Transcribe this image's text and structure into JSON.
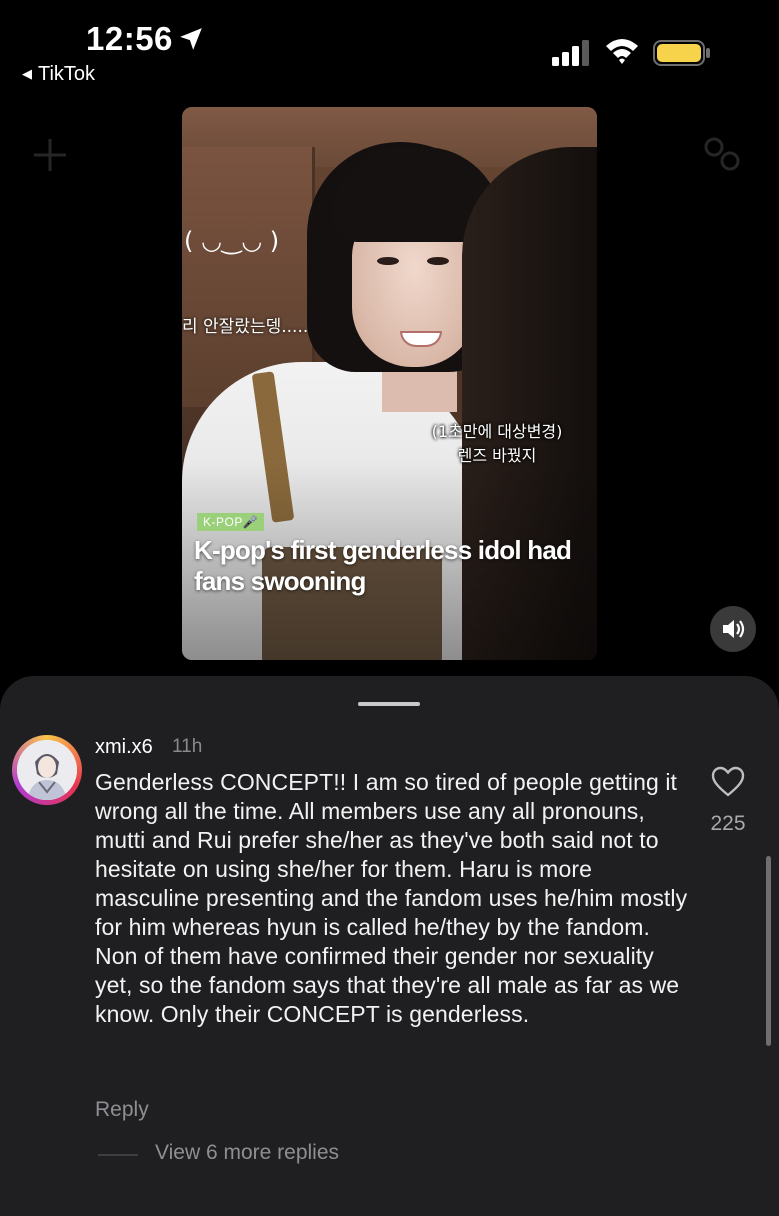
{
  "status_bar": {
    "time": "12:56",
    "back_app": "TikTok",
    "battery_color": "#f6d34a"
  },
  "video": {
    "kaomoji": "( ◡‿◡ )",
    "subtitle_top": "리 안잘랐는뎅.....",
    "subtitle_line1": "(1초만에 대상변경)",
    "subtitle_line2": "렌즈 바꿨지",
    "tag": "K-POP🎤",
    "headline": "K-pop's first genderless idol had fans swooning",
    "sound_icon": "speaker-icon"
  },
  "comment": {
    "username": "xmi.x6",
    "age": "11h",
    "text": "Genderless CONCEPT!! I am so tired of people getting it wrong all the time. All members use any all pronouns, mutti and Rui prefer she/her as they've both said not to hesitate on using she/her for them. Haru is more masculine presenting and the fandom uses he/him mostly for him whereas hyun is called he/they by the fandom. Non of them have confirmed their gender nor sexuality yet, so the fandom says that they're all male as far as we know. Only their CONCEPT is genderless.",
    "likes": "225",
    "reply_label": "Reply",
    "view_more_label": "View 6 more replies"
  }
}
